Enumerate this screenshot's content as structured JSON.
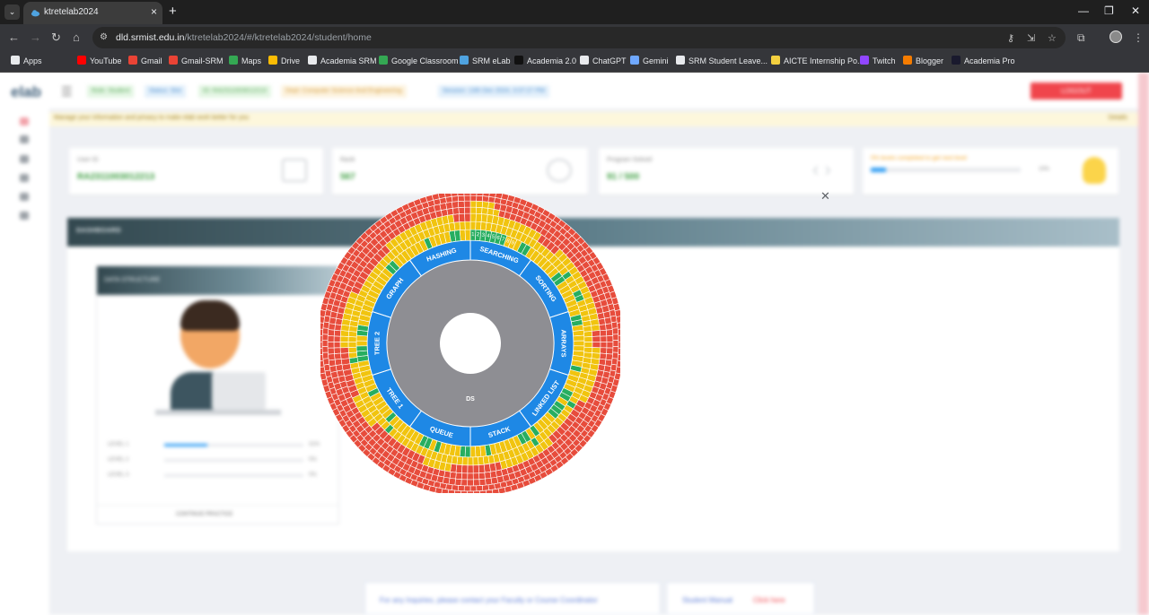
{
  "browser": {
    "tab_title": "ktretelab2024",
    "url_host": "dld.srmist.edu.in",
    "url_path": "/ktretelab2024/#/ktretelab2024/student/home",
    "tab_list_icon": "chevron-down-icon",
    "bookmarks": [
      {
        "label": "Apps",
        "color": "#e8eaed"
      },
      {
        "label": "YouTube",
        "color": "#ff0000"
      },
      {
        "label": "Gmail",
        "color": "#ea4335"
      },
      {
        "label": "Gmail-SRM",
        "color": "#ea4335"
      },
      {
        "label": "Maps",
        "color": "#34a853"
      },
      {
        "label": "Drive",
        "color": "#fbbc04"
      },
      {
        "label": "Academia SRM",
        "color": "#e8eaed"
      },
      {
        "label": "Google Classroom",
        "color": "#34a853"
      },
      {
        "label": "SRM eLab",
        "color": "#4fa3e0"
      },
      {
        "label": "Academia 2.0",
        "color": "#111111"
      },
      {
        "label": "ChatGPT",
        "color": "#e8eaed"
      },
      {
        "label": "Gemini",
        "color": "#6fa8ff"
      },
      {
        "label": "SRM Student Leave...",
        "color": "#e8eaed"
      },
      {
        "label": "AICTE Internship Po...",
        "color": "#f4d03f"
      },
      {
        "label": "Twitch",
        "color": "#9146ff"
      },
      {
        "label": "Blogger",
        "color": "#f57c00"
      },
      {
        "label": "Academia Pro",
        "color": "#1a1a2e"
      }
    ]
  },
  "page": {
    "logo": "elab",
    "chips": [
      {
        "text": "Role: Student",
        "bg": "#e4f6e4",
        "fg": "#5aa85a"
      },
      {
        "text": "Status: Slot",
        "bg": "#e3f0fb",
        "fg": "#4d8ecf"
      },
      {
        "text": "ID: RA2311003012213",
        "bg": "#e4f6e4",
        "fg": "#5aa85a"
      },
      {
        "text": "Dept: Computer Science And Engineering",
        "bg": "#fdf3df",
        "fg": "#d39a3a"
      },
      {
        "text": "Session: 13th Dec 2024, 3:37:27 PM",
        "bg": "#e3f0fb",
        "fg": "#4d8ecf"
      }
    ],
    "logout": "LOGOUT",
    "notice": "Manage your information and privacy to make elab work better for you",
    "notice_right": "Details",
    "cards": [
      {
        "label": "User ID",
        "value": "RA2311003012213"
      },
      {
        "label": "Rank",
        "value": "567"
      },
      {
        "label": "Program Solved",
        "value": "91 / 500"
      }
    ],
    "progress": {
      "title": "0% levels completed to get next level",
      "pct": "10%",
      "fill": 0.1
    },
    "dashboard_title": "DASHBOARD",
    "ds_title": "DATA STRUCTURE",
    "levels": [
      {
        "label": "LEVEL 1",
        "pct": "31%",
        "fill": 0.31
      },
      {
        "label": "LEVEL 2",
        "pct": "0%",
        "fill": 0
      },
      {
        "label": "LEVEL 3",
        "pct": "0%",
        "fill": 0
      }
    ],
    "ds_footer": "CONTINUE PRACTICE",
    "help": "For any Inquiries, please contact your Faculty or Course Coordinator",
    "manual": "Student Manual",
    "manual_link": "Click here"
  },
  "chart_data": {
    "type": "sunburst",
    "root": "DS",
    "categories": [
      "SEARCHING",
      "SORTING",
      "ARRAYS",
      "LINKED LIST",
      "STACK",
      "QUEUE",
      "TREE 1",
      "TREE 2",
      "GRAPH",
      "HASHING"
    ],
    "searching_question_labels": [
      "1",
      "2",
      "3",
      "4",
      "5",
      "6",
      "7",
      "8",
      "9"
    ],
    "status_legend": {
      "solved": "#27ae60",
      "partial": "#f1c40f",
      "unsolved": "#e74c3c"
    },
    "category_color": "#1e88e5",
    "root_color": "#8e8e93",
    "levels": [
      {
        "name": "L1",
        "cells": "GGGGGGGYYYGGYYYYYYYGGYYYYYYYGGYYYYYYYYGYYYYGGYGGGYYYYGYGGYYYYYYGYYYGGYYYYGYGGYYYYYYYGYYYYYGYYYYYYGGGYYGGYYYYYYYYYYYYGGYYYYYYYGYYYYGGYY"
      },
      {
        "name": "L2",
        "cells": "YYYYYYYYYYYYYYYYYYYYYGYYYGGYYYYYYYYYYYYYYYYYYYYGYYYYYYYYYGYYYYYYYYYYYYYYYYYYYYYYYYYYYYYGYYYYYYYYYYYYYYGYYYYYYYYYYYYYYYYYYYYYYYYYYYYYYYYYYYYYY"
      },
      {
        "name": "L3",
        "cells": "YYYYYYYYYYYYYRRRRYYYYYYYYYYYYYYYYRRRYYYYYYYYYYRRRRRRRRRYYYYYYYYYYRRRRRRRRRYYYYYRRRRRRRRRRRYYYYYYRRRRRRRRRYYYYYYYYYYRRRRRRRRRRYYYYYYYYYYYYYRRR"
      },
      {
        "name": "L4",
        "cells": "YYYYYRRRRRRRRRRRRRRRRRRRRRRRRRRRRRRRRRRRRRRRRRRRRRRRRRRRRRRRRRRRRRRRRRRRRRRRRRRRRRRRRRRRRRRRRRRRRRRRRRRRRRRRRRRRRRRRRRRRRRRRRRRRRRRRRRRRRRRRRRRRR"
      },
      {
        "name": "L5",
        "cells": "YYYYRRRRRRRRRRRRRRRRRRRRRRRRRRRRRRRRRRRRRRRRRRRRRRRRRRRRRRRRRRRRRRRRRRRRRRRRRRRRRRRRRRRRRRRRRRRRRRRRRRRRRRRRRRRRRRRRRRRRRRRRRRRRRRRRRRRRRRRRRRRRR"
      },
      {
        "name": "L6",
        "cells": "RRRRRRRRRRRRRRRRRRRRRRRRRRRRRRRRRRRRRRRRRRRRRRRRRRRRRRRRRRRRRRRRRRRRRRRRRRRRRRRRRRRRRRRRRRRRRRRRRRRRRRRRRRRRRRRRRRRRRRRRRRRRRRRRRRRRRRRRRRRRRRRRRRRRRR"
      },
      {
        "name": "L7",
        "cells": "RRRRRRRRRRRRRRRRRRRRRRRRRRRRRRRRRRRRRRRRRRRRRRRRRRRRRRRRRRRRRRRRRRRRRRRRRRRRRRRRRRRRRRRRRRRRRRRRRRRRRRRRRRRRRRRRRRRRRRRRRRRRRRRRRRRRRRRRRRRRRRRRRRRRR"
      }
    ]
  }
}
